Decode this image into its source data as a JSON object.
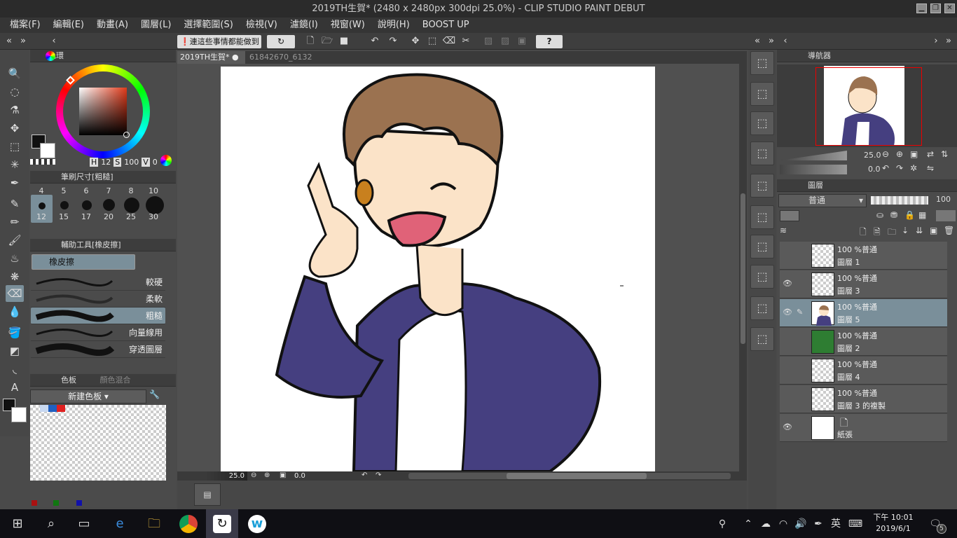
{
  "window": {
    "title": "2019TH生賀* (2480 x 2480px 300dpi 25.0%)  - CLIP STUDIO PAINT DEBUT",
    "min": "▁",
    "restore": "❐",
    "close": "✕"
  },
  "menu": [
    "檔案(F)",
    "編輯(E)",
    "動畫(A)",
    "圖層(L)",
    "選擇範圍(S)",
    "檢視(V)",
    "濾鏡(I)",
    "視窗(W)",
    "說明(H)",
    "BOOST UP"
  ],
  "toolbar": {
    "tip_button": "連這些事情都能做到",
    "help": "?"
  },
  "tabs": [
    "2019TH生賀*",
    "61842670_6132"
  ],
  "color": {
    "title": "色環",
    "h": "H",
    "h_val": "12",
    "s": "S",
    "s_val": "100",
    "v": "V",
    "v_val": "0",
    "fg": "#111111",
    "bg": "#ffffff"
  },
  "brush_size": {
    "title": "筆刷尺寸[粗糙]",
    "top_sizes": [
      "4",
      "5",
      "6",
      "7",
      "8",
      "10"
    ],
    "sizes": [
      "12",
      "15",
      "17",
      "20",
      "25",
      "30"
    ]
  },
  "subtool": {
    "title": "輔助工具[橡皮擦]",
    "group": "橡皮擦",
    "items": [
      "較硬",
      "柔軟",
      "粗糙",
      "向量線用",
      "穿透圖層"
    ],
    "selected": "粗糙"
  },
  "palette": {
    "title": "色板",
    "tab2": "顏色混合",
    "name": "新建色板",
    "swatches": [
      "#c8d8f0",
      "#2060c0",
      "#e02020"
    ],
    "bottom": [
      "#aa1111",
      "#117711",
      "#1111aa"
    ]
  },
  "canvas": {
    "zoom": "25.0",
    "angle": "0.0"
  },
  "navigator": {
    "title": "導航器",
    "zoom": "25.0",
    "angle": "0.0"
  },
  "layers": {
    "title": "圖層",
    "blend": "普通",
    "opacity": "100",
    "items": [
      {
        "pct": "100 %普通",
        "name": "圖層 1",
        "color": "",
        "visible": false,
        "active": false
      },
      {
        "pct": "100 %普通",
        "name": "圖層 3",
        "color": "",
        "visible": true,
        "active": false
      },
      {
        "pct": "100 %普通",
        "name": "圖層 5",
        "color": "#4a4a9a",
        "visible": true,
        "active": true
      },
      {
        "pct": "100 %普通",
        "name": "圖層 2",
        "color": "#2e7d32",
        "visible": false,
        "active": false
      },
      {
        "pct": "100 %普通",
        "name": "圖層 4",
        "color": "",
        "visible": false,
        "active": false
      },
      {
        "pct": "100 %普通",
        "name": "圖層 3 的複製",
        "color": "",
        "visible": false,
        "active": false
      },
      {
        "pct": "",
        "name": "紙張",
        "color": "#ffffff",
        "visible": true,
        "active": false
      }
    ]
  },
  "taskbar": {
    "ime": "英",
    "time": "下午 10:01",
    "date": "2019/6/1",
    "notif": "5"
  }
}
